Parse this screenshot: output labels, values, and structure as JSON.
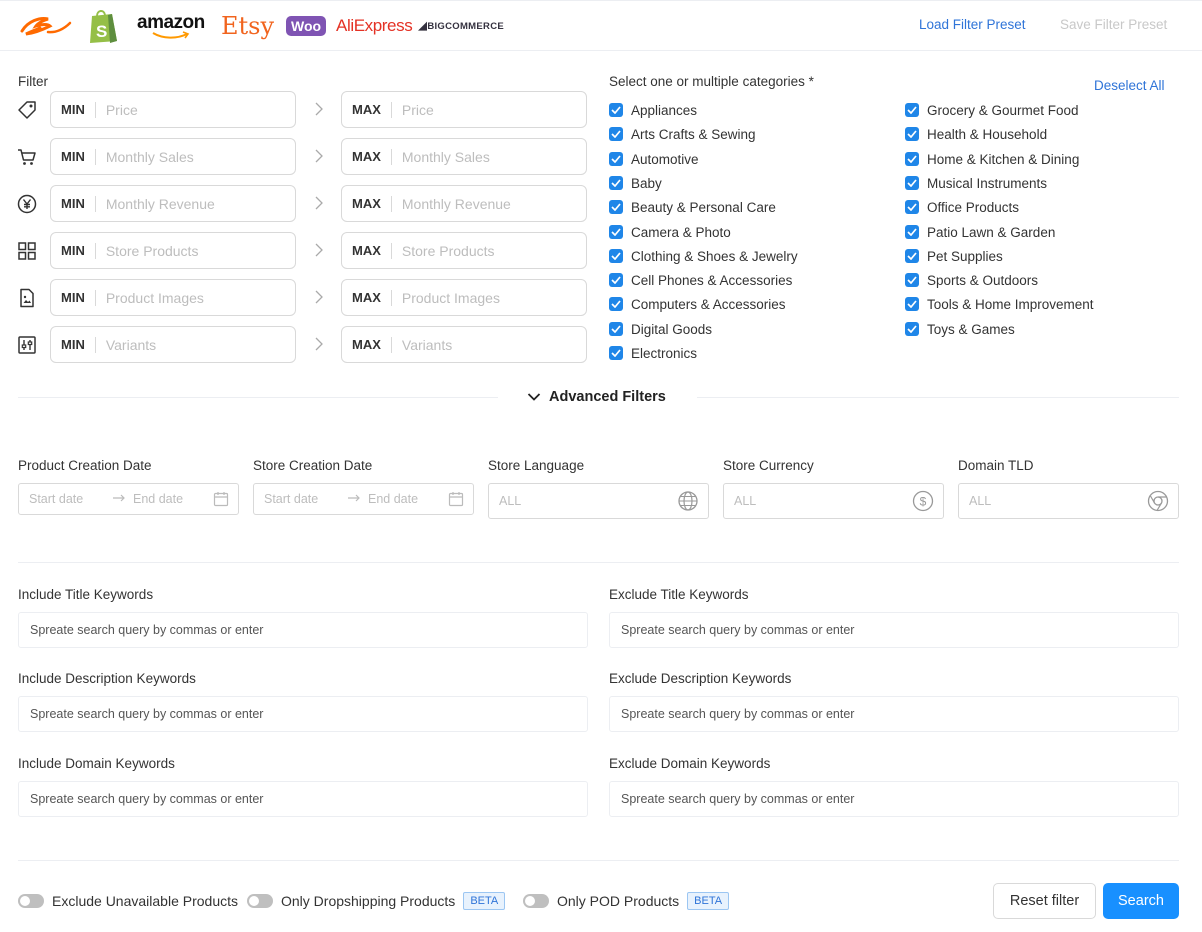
{
  "header": {
    "platforms": {
      "amazon": "amazon",
      "etsy": "Etsy",
      "woo": "Woo",
      "aliexpress": "AliExpress",
      "bigcommerce": "BIGCOMMERCE"
    },
    "load_preset": "Load Filter Preset",
    "save_preset": "Save Filter Preset"
  },
  "filters": {
    "label": "Filter",
    "min_tag": "MIN",
    "max_tag": "MAX",
    "rows": [
      {
        "icon": "price-tag-icon",
        "placeholder": "Price"
      },
      {
        "icon": "cart-icon",
        "placeholder": "Monthly Sales"
      },
      {
        "icon": "yen-coin-icon",
        "placeholder": "Monthly Revenue"
      },
      {
        "icon": "grid-icon",
        "placeholder": "Store Products"
      },
      {
        "icon": "image-file-icon",
        "placeholder": "Product Images"
      },
      {
        "icon": "sliders-icon",
        "placeholder": "Variants"
      }
    ]
  },
  "categories": {
    "title": "Select one or multiple categories *",
    "deselect_all": "Deselect All",
    "left": [
      "Appliances",
      "Arts Crafts & Sewing",
      "Automotive",
      "Baby",
      "Beauty & Personal Care",
      "Camera & Photo",
      "Clothing & Shoes & Jewelry",
      "Cell Phones & Accessories",
      "Computers & Accessories",
      "Digital Goods",
      "Electronics"
    ],
    "right": [
      "Grocery & Gourmet Food",
      "Health & Household",
      "Home & Kitchen & Dining",
      "Musical Instruments",
      "Office Products",
      "Patio Lawn & Garden",
      "Pet Supplies",
      "Sports & Outdoors",
      "Tools & Home Improvement",
      "Toys & Games"
    ],
    "checked": true
  },
  "advanced": {
    "toggle_label": "Advanced Filters",
    "product_creation_date": {
      "label": "Product Creation Date",
      "start": "Start date",
      "end": "End date"
    },
    "store_creation_date": {
      "label": "Store Creation Date",
      "start": "Start date",
      "end": "End date"
    },
    "store_language": {
      "label": "Store Language",
      "placeholder": "ALL",
      "icon": "globe-icon"
    },
    "store_currency": {
      "label": "Store Currency",
      "placeholder": "ALL",
      "icon": "dollar-circle-icon"
    },
    "domain_tld": {
      "label": "Domain TLD",
      "placeholder": "ALL",
      "icon": "chrome-icon"
    }
  },
  "keywords": {
    "placeholder": "Spreate search query by commas or enter",
    "include_title": "Include Title Keywords",
    "exclude_title": "Exclude Title Keywords",
    "include_description": "Include Description Keywords",
    "exclude_description": "Exclude Description Keywords",
    "include_domain": "Include Domain Keywords",
    "exclude_domain": "Exclude Domain Keywords"
  },
  "footer": {
    "exclude_unavailable": "Exclude Unavailable Products",
    "only_dropshipping": "Only Dropshipping Products",
    "only_pod": "Only POD Products",
    "beta": "BETA",
    "reset": "Reset filter",
    "search": "Search",
    "accent": "#1890ff"
  }
}
